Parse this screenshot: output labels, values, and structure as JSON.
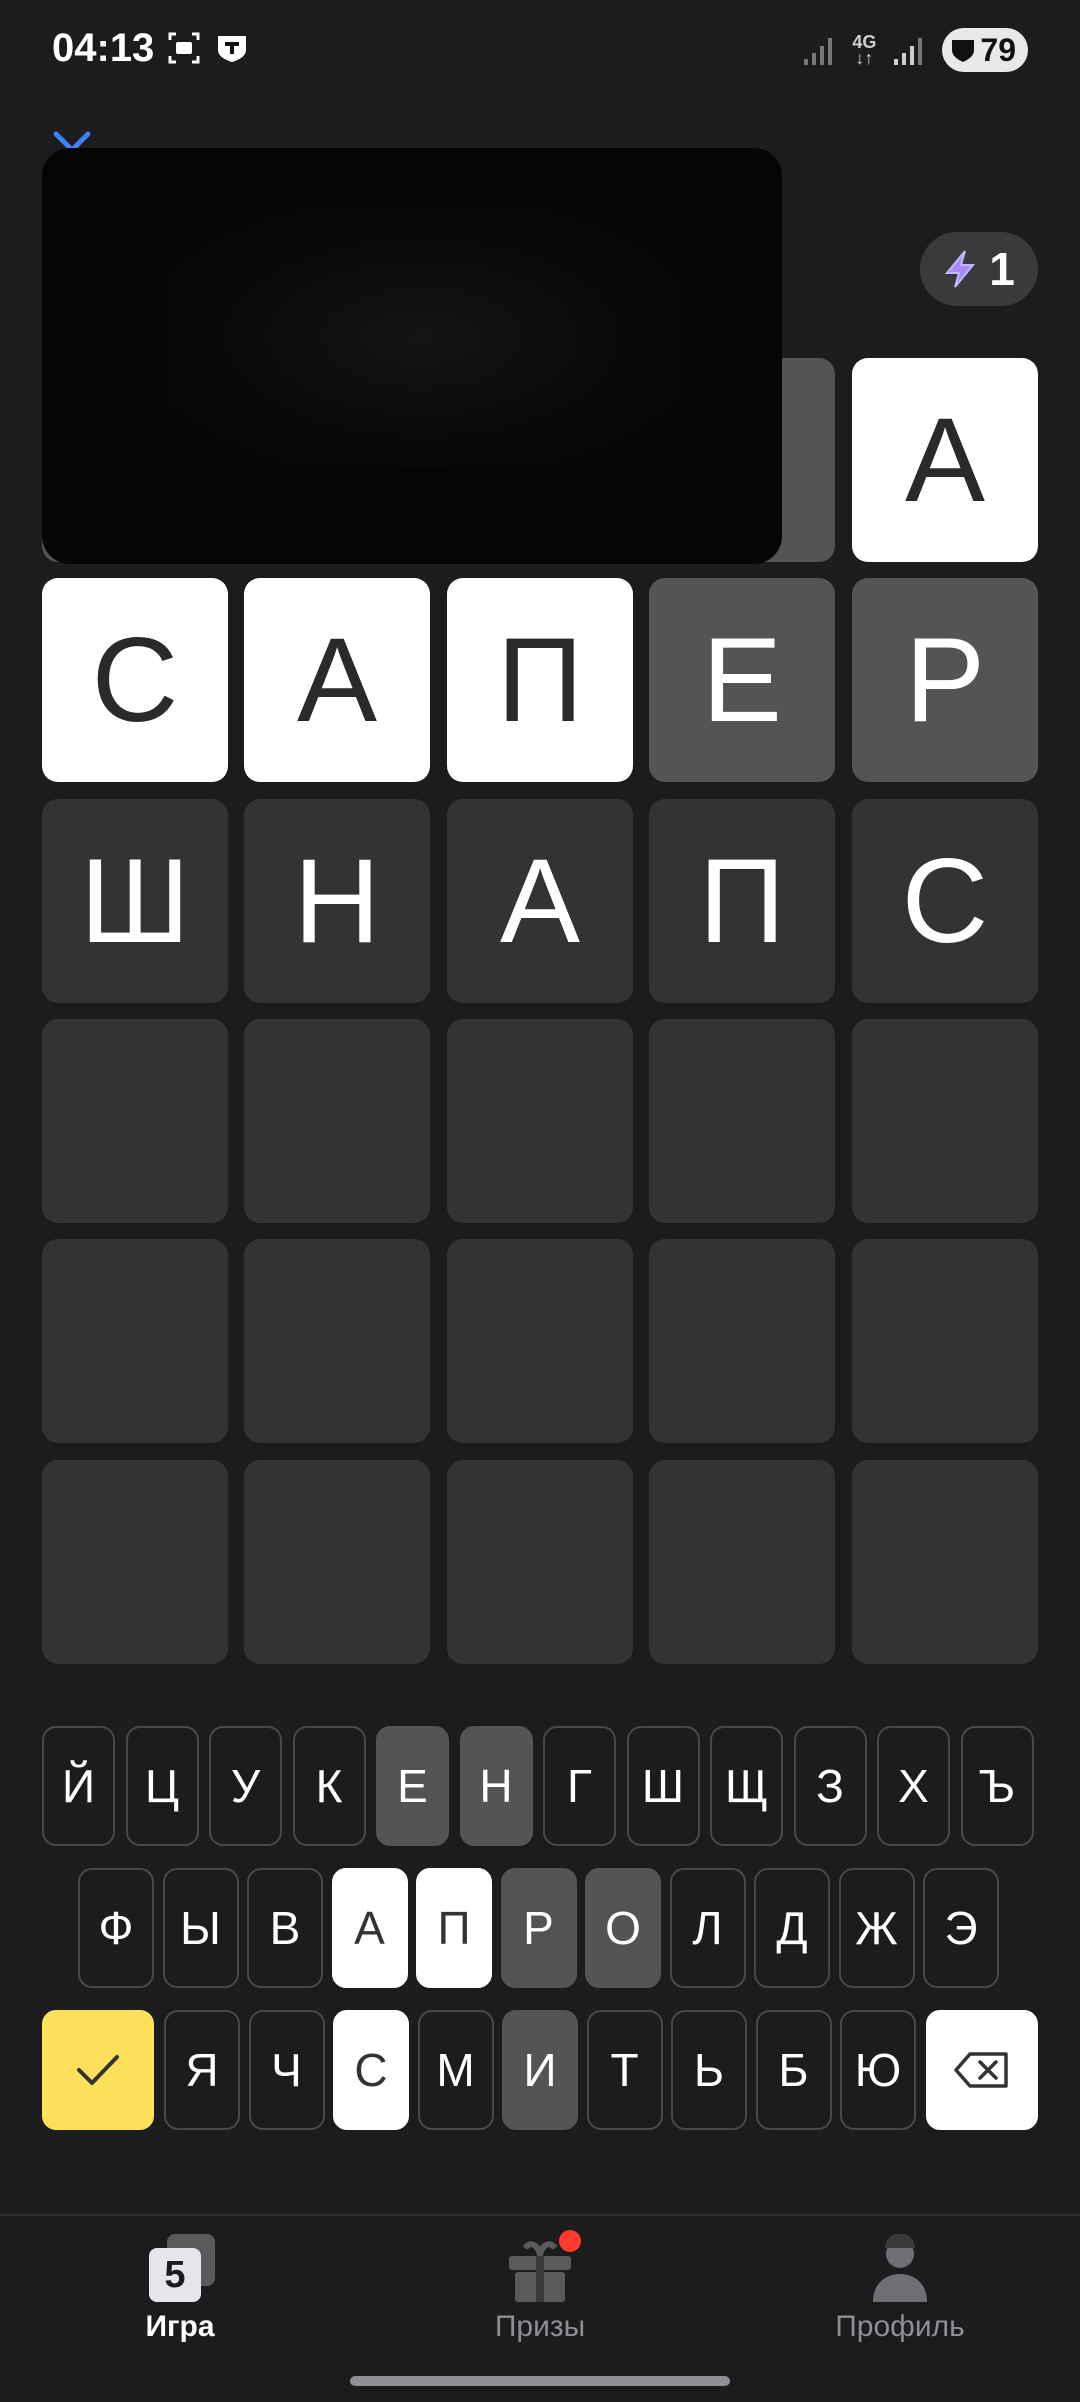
{
  "status_bar": {
    "time": "04:13",
    "network": "4G",
    "battery": "79"
  },
  "energy": {
    "count": "1",
    "color": "#a78bfa"
  },
  "board": {
    "rows": [
      [
        {
          "letter": "",
          "state": "hidden"
        },
        {
          "letter": "",
          "state": "hidden"
        },
        {
          "letter": "",
          "state": "hidden"
        },
        {
          "letter": "",
          "state": "present"
        },
        {
          "letter": "А",
          "state": "correct"
        }
      ],
      [
        {
          "letter": "С",
          "state": "correct"
        },
        {
          "letter": "А",
          "state": "correct"
        },
        {
          "letter": "П",
          "state": "correct"
        },
        {
          "letter": "Е",
          "state": "present"
        },
        {
          "letter": "Р",
          "state": "present"
        }
      ],
      [
        {
          "letter": "Ш",
          "state": "absent"
        },
        {
          "letter": "Н",
          "state": "absent"
        },
        {
          "letter": "А",
          "state": "absent"
        },
        {
          "letter": "П",
          "state": "absent"
        },
        {
          "letter": "С",
          "state": "absent"
        }
      ],
      [
        {
          "letter": "",
          "state": "empty"
        },
        {
          "letter": "",
          "state": "empty"
        },
        {
          "letter": "",
          "state": "empty"
        },
        {
          "letter": "",
          "state": "empty"
        },
        {
          "letter": "",
          "state": "empty"
        }
      ],
      [
        {
          "letter": "",
          "state": "empty"
        },
        {
          "letter": "",
          "state": "empty"
        },
        {
          "letter": "",
          "state": "empty"
        },
        {
          "letter": "",
          "state": "empty"
        },
        {
          "letter": "",
          "state": "empty"
        }
      ],
      [
        {
          "letter": "",
          "state": "empty"
        },
        {
          "letter": "",
          "state": "empty"
        },
        {
          "letter": "",
          "state": "empty"
        },
        {
          "letter": "",
          "state": "empty"
        },
        {
          "letter": "",
          "state": "empty"
        }
      ]
    ]
  },
  "keyboard": {
    "row1": [
      {
        "k": "Й",
        "s": "absent"
      },
      {
        "k": "Ц",
        "s": "absent"
      },
      {
        "k": "У",
        "s": "absent"
      },
      {
        "k": "К",
        "s": "absent"
      },
      {
        "k": "Е",
        "s": "present"
      },
      {
        "k": "Н",
        "s": "present"
      },
      {
        "k": "Г",
        "s": "absent"
      },
      {
        "k": "Ш",
        "s": "absent"
      },
      {
        "k": "Щ",
        "s": "absent"
      },
      {
        "k": "З",
        "s": "absent"
      },
      {
        "k": "Х",
        "s": "absent"
      },
      {
        "k": "Ъ",
        "s": "absent"
      }
    ],
    "row2": [
      {
        "k": "Ф",
        "s": "absent"
      },
      {
        "k": "Ы",
        "s": "absent"
      },
      {
        "k": "В",
        "s": "absent"
      },
      {
        "k": "А",
        "s": "correct"
      },
      {
        "k": "П",
        "s": "correct"
      },
      {
        "k": "Р",
        "s": "present"
      },
      {
        "k": "О",
        "s": "present"
      },
      {
        "k": "Л",
        "s": "absent"
      },
      {
        "k": "Д",
        "s": "absent"
      },
      {
        "k": "Ж",
        "s": "absent"
      },
      {
        "k": "Э",
        "s": "absent"
      }
    ],
    "row3": [
      {
        "k": "Я",
        "s": "absent"
      },
      {
        "k": "Ч",
        "s": "absent"
      },
      {
        "k": "С",
        "s": "correct"
      },
      {
        "k": "М",
        "s": "absent"
      },
      {
        "k": "И",
        "s": "present"
      },
      {
        "k": "Т",
        "s": "absent"
      },
      {
        "k": "Ь",
        "s": "absent"
      },
      {
        "k": "Б",
        "s": "absent"
      },
      {
        "k": "Ю",
        "s": "absent"
      }
    ],
    "enter_icon": "check-icon",
    "backspace_icon": "backspace-icon"
  },
  "nav": {
    "items": [
      {
        "label": "Игра",
        "icon": "game-icon",
        "active": true,
        "logo_text": "5"
      },
      {
        "label": "Призы",
        "icon": "gift-icon",
        "active": false,
        "badge": true
      },
      {
        "label": "Профиль",
        "icon": "profile-icon",
        "active": false
      }
    ]
  },
  "colors": {
    "correct": "#ffffff",
    "present": "#545456",
    "absent": "#333335",
    "enter": "#fde05a",
    "background": "#1c1c1e",
    "badge": "#ff3b30"
  }
}
